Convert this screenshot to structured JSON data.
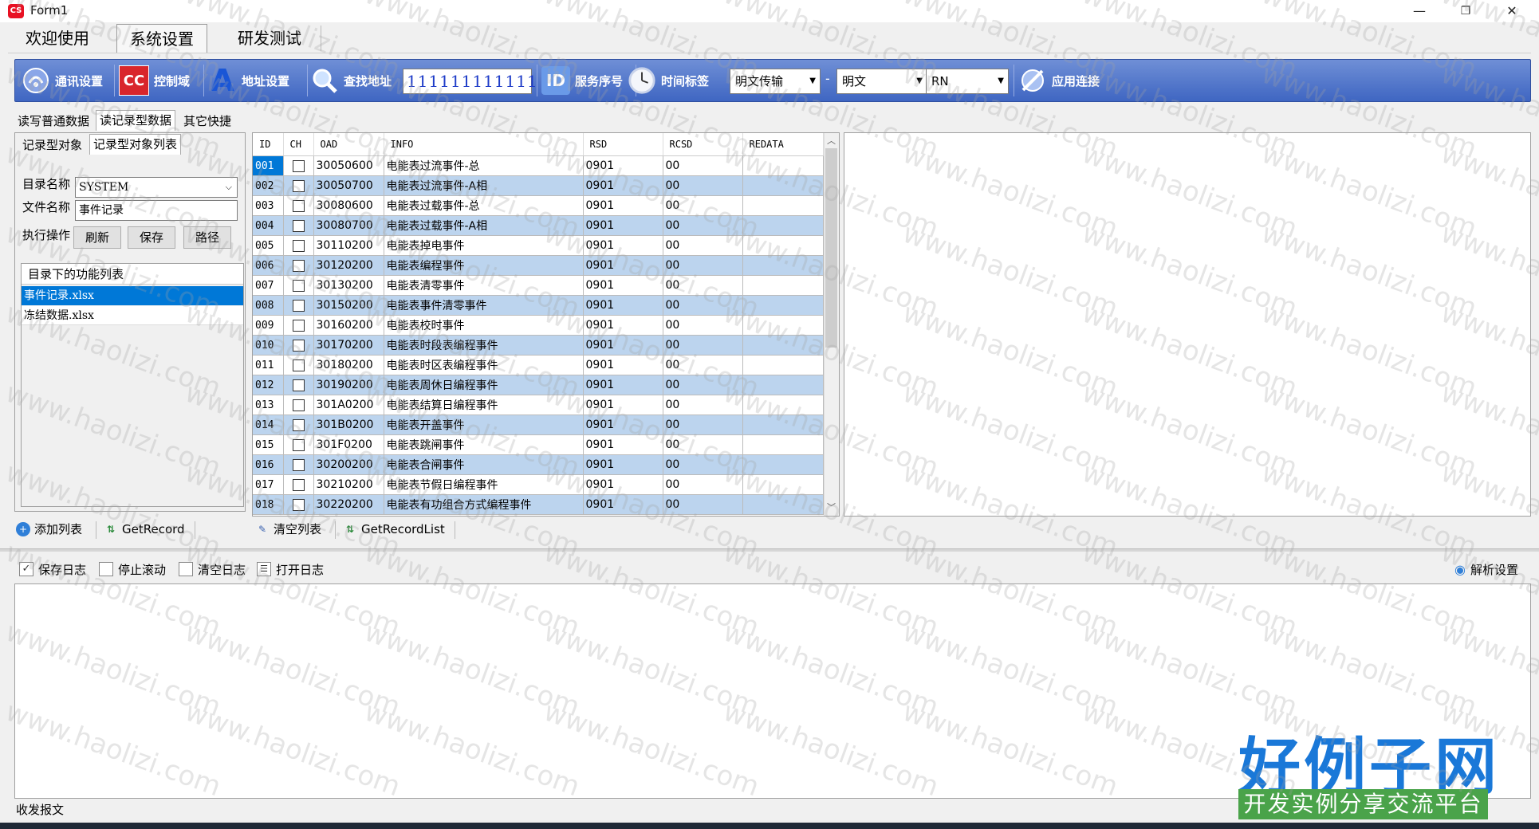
{
  "window": {
    "title": "Form1",
    "icon_text": "CS",
    "minimize": "—",
    "restore": "❐",
    "close": "✕"
  },
  "main_tabs": [
    "欢迎使用",
    "系统设置",
    "研发测试"
  ],
  "toolbar": {
    "comm_settings": "通讯设置",
    "cc_icon": "CC",
    "control_domain": "控制域",
    "address_icon": "A",
    "address_settings": "地址设置",
    "find_address": "查找地址",
    "address_value": "111111111111",
    "id_icon": "ID",
    "service_seq": "服务序号",
    "time_tag": "时间标签",
    "transfer_mode": "明文传输",
    "mode": "明文",
    "rn": "RN",
    "app_connect": "应用连接",
    "dash": "-"
  },
  "sub_tabs": [
    "读写普通数据",
    "读记录型数据",
    "其它快捷"
  ],
  "left_tabs": [
    "记录型对象",
    "记录型对象列表"
  ],
  "left_panel": {
    "dir_label": "目录名称",
    "dir_value": "SYSTEM",
    "file_label": "文件名称",
    "file_value": "事件记录",
    "exec_label": "执行操作",
    "refresh": "刷新",
    "save": "保存",
    "path": "路径",
    "list_header": "目录下的功能列表",
    "files": [
      "事件记录.xlsx",
      "冻结数据.xlsx"
    ]
  },
  "grid": {
    "columns": [
      "ID",
      "CH",
      "OAD",
      "INFO",
      "RSD",
      "RCSD",
      "REDATA"
    ],
    "rows": [
      {
        "id": "001",
        "oad": "30050600",
        "info": "电能表过流事件-总",
        "rsd": "0901",
        "rcsd": "00"
      },
      {
        "id": "002",
        "oad": "30050700",
        "info": "电能表过流事件-A相",
        "rsd": "0901",
        "rcsd": "00"
      },
      {
        "id": "003",
        "oad": "30080600",
        "info": "电能表过载事件-总",
        "rsd": "0901",
        "rcsd": "00"
      },
      {
        "id": "004",
        "oad": "30080700",
        "info": "电能表过载事件-A相",
        "rsd": "0901",
        "rcsd": "00"
      },
      {
        "id": "005",
        "oad": "30110200",
        "info": "电能表掉电事件",
        "rsd": "0901",
        "rcsd": "00"
      },
      {
        "id": "006",
        "oad": "30120200",
        "info": "电能表编程事件",
        "rsd": "0901",
        "rcsd": "00"
      },
      {
        "id": "007",
        "oad": "30130200",
        "info": "电能表清零事件",
        "rsd": "0901",
        "rcsd": "00"
      },
      {
        "id": "008",
        "oad": "30150200",
        "info": "电能表事件清零事件",
        "rsd": "0901",
        "rcsd": "00"
      },
      {
        "id": "009",
        "oad": "30160200",
        "info": "电能表校时事件",
        "rsd": "0901",
        "rcsd": "00"
      },
      {
        "id": "010",
        "oad": "30170200",
        "info": "电能表时段表编程事件",
        "rsd": "0901",
        "rcsd": "00"
      },
      {
        "id": "011",
        "oad": "30180200",
        "info": "电能表时区表编程事件",
        "rsd": "0901",
        "rcsd": "00"
      },
      {
        "id": "012",
        "oad": "30190200",
        "info": "电能表周休日编程事件",
        "rsd": "0901",
        "rcsd": "00"
      },
      {
        "id": "013",
        "oad": "301A0200",
        "info": "电能表结算日编程事件",
        "rsd": "0901",
        "rcsd": "00"
      },
      {
        "id": "014",
        "oad": "301B0200",
        "info": "电能表开盖事件",
        "rsd": "0901",
        "rcsd": "00"
      },
      {
        "id": "015",
        "oad": "301F0200",
        "info": "电能表跳闸事件",
        "rsd": "0901",
        "rcsd": "00"
      },
      {
        "id": "016",
        "oad": "30200200",
        "info": "电能表合闸事件",
        "rsd": "0901",
        "rcsd": "00"
      },
      {
        "id": "017",
        "oad": "30210200",
        "info": "电能表节假日编程事件",
        "rsd": "0901",
        "rcsd": "00"
      },
      {
        "id": "018",
        "oad": "30220200",
        "info": "电能表有功组合方式编程事件",
        "rsd": "0901",
        "rcsd": "00"
      }
    ]
  },
  "actions": {
    "add_list": "添加列表",
    "get_record": "GetRecord",
    "clear_list": "清空列表",
    "get_record_list": "GetRecordList"
  },
  "log": {
    "save_log": "保存日志",
    "stop_scroll": "停止滚动",
    "clear_log": "清空日志",
    "open_log": "打开日志",
    "parse_settings": "解析设置",
    "status_tab": "收发报文"
  },
  "watermark": "www.haolizi.com",
  "brand": {
    "main": "好例子网",
    "sub": "开发实例分享交流平台"
  }
}
